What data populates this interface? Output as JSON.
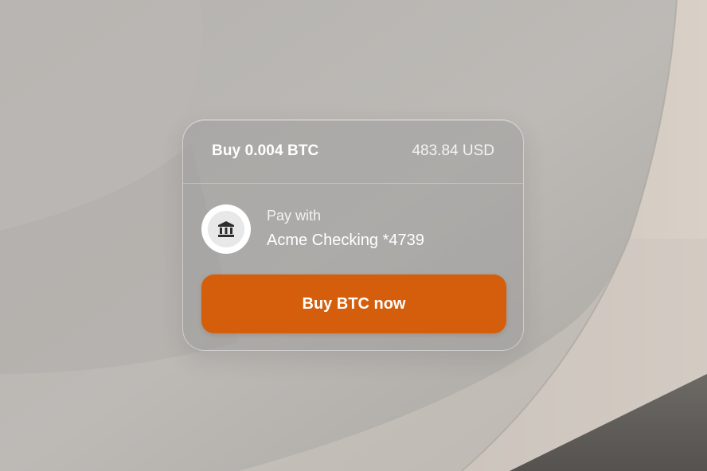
{
  "order": {
    "title": "Buy 0.004 BTC",
    "usd_amount": "483.84 USD"
  },
  "payment": {
    "label": "Pay with",
    "account": "Acme Checking *4739",
    "icon": "bank-icon"
  },
  "actions": {
    "buy_label": "Buy BTC now"
  },
  "colors": {
    "accent": "#d45e0b",
    "card_tint": "rgba(150,150,150,0.42)",
    "background": "#b8b5b1"
  }
}
